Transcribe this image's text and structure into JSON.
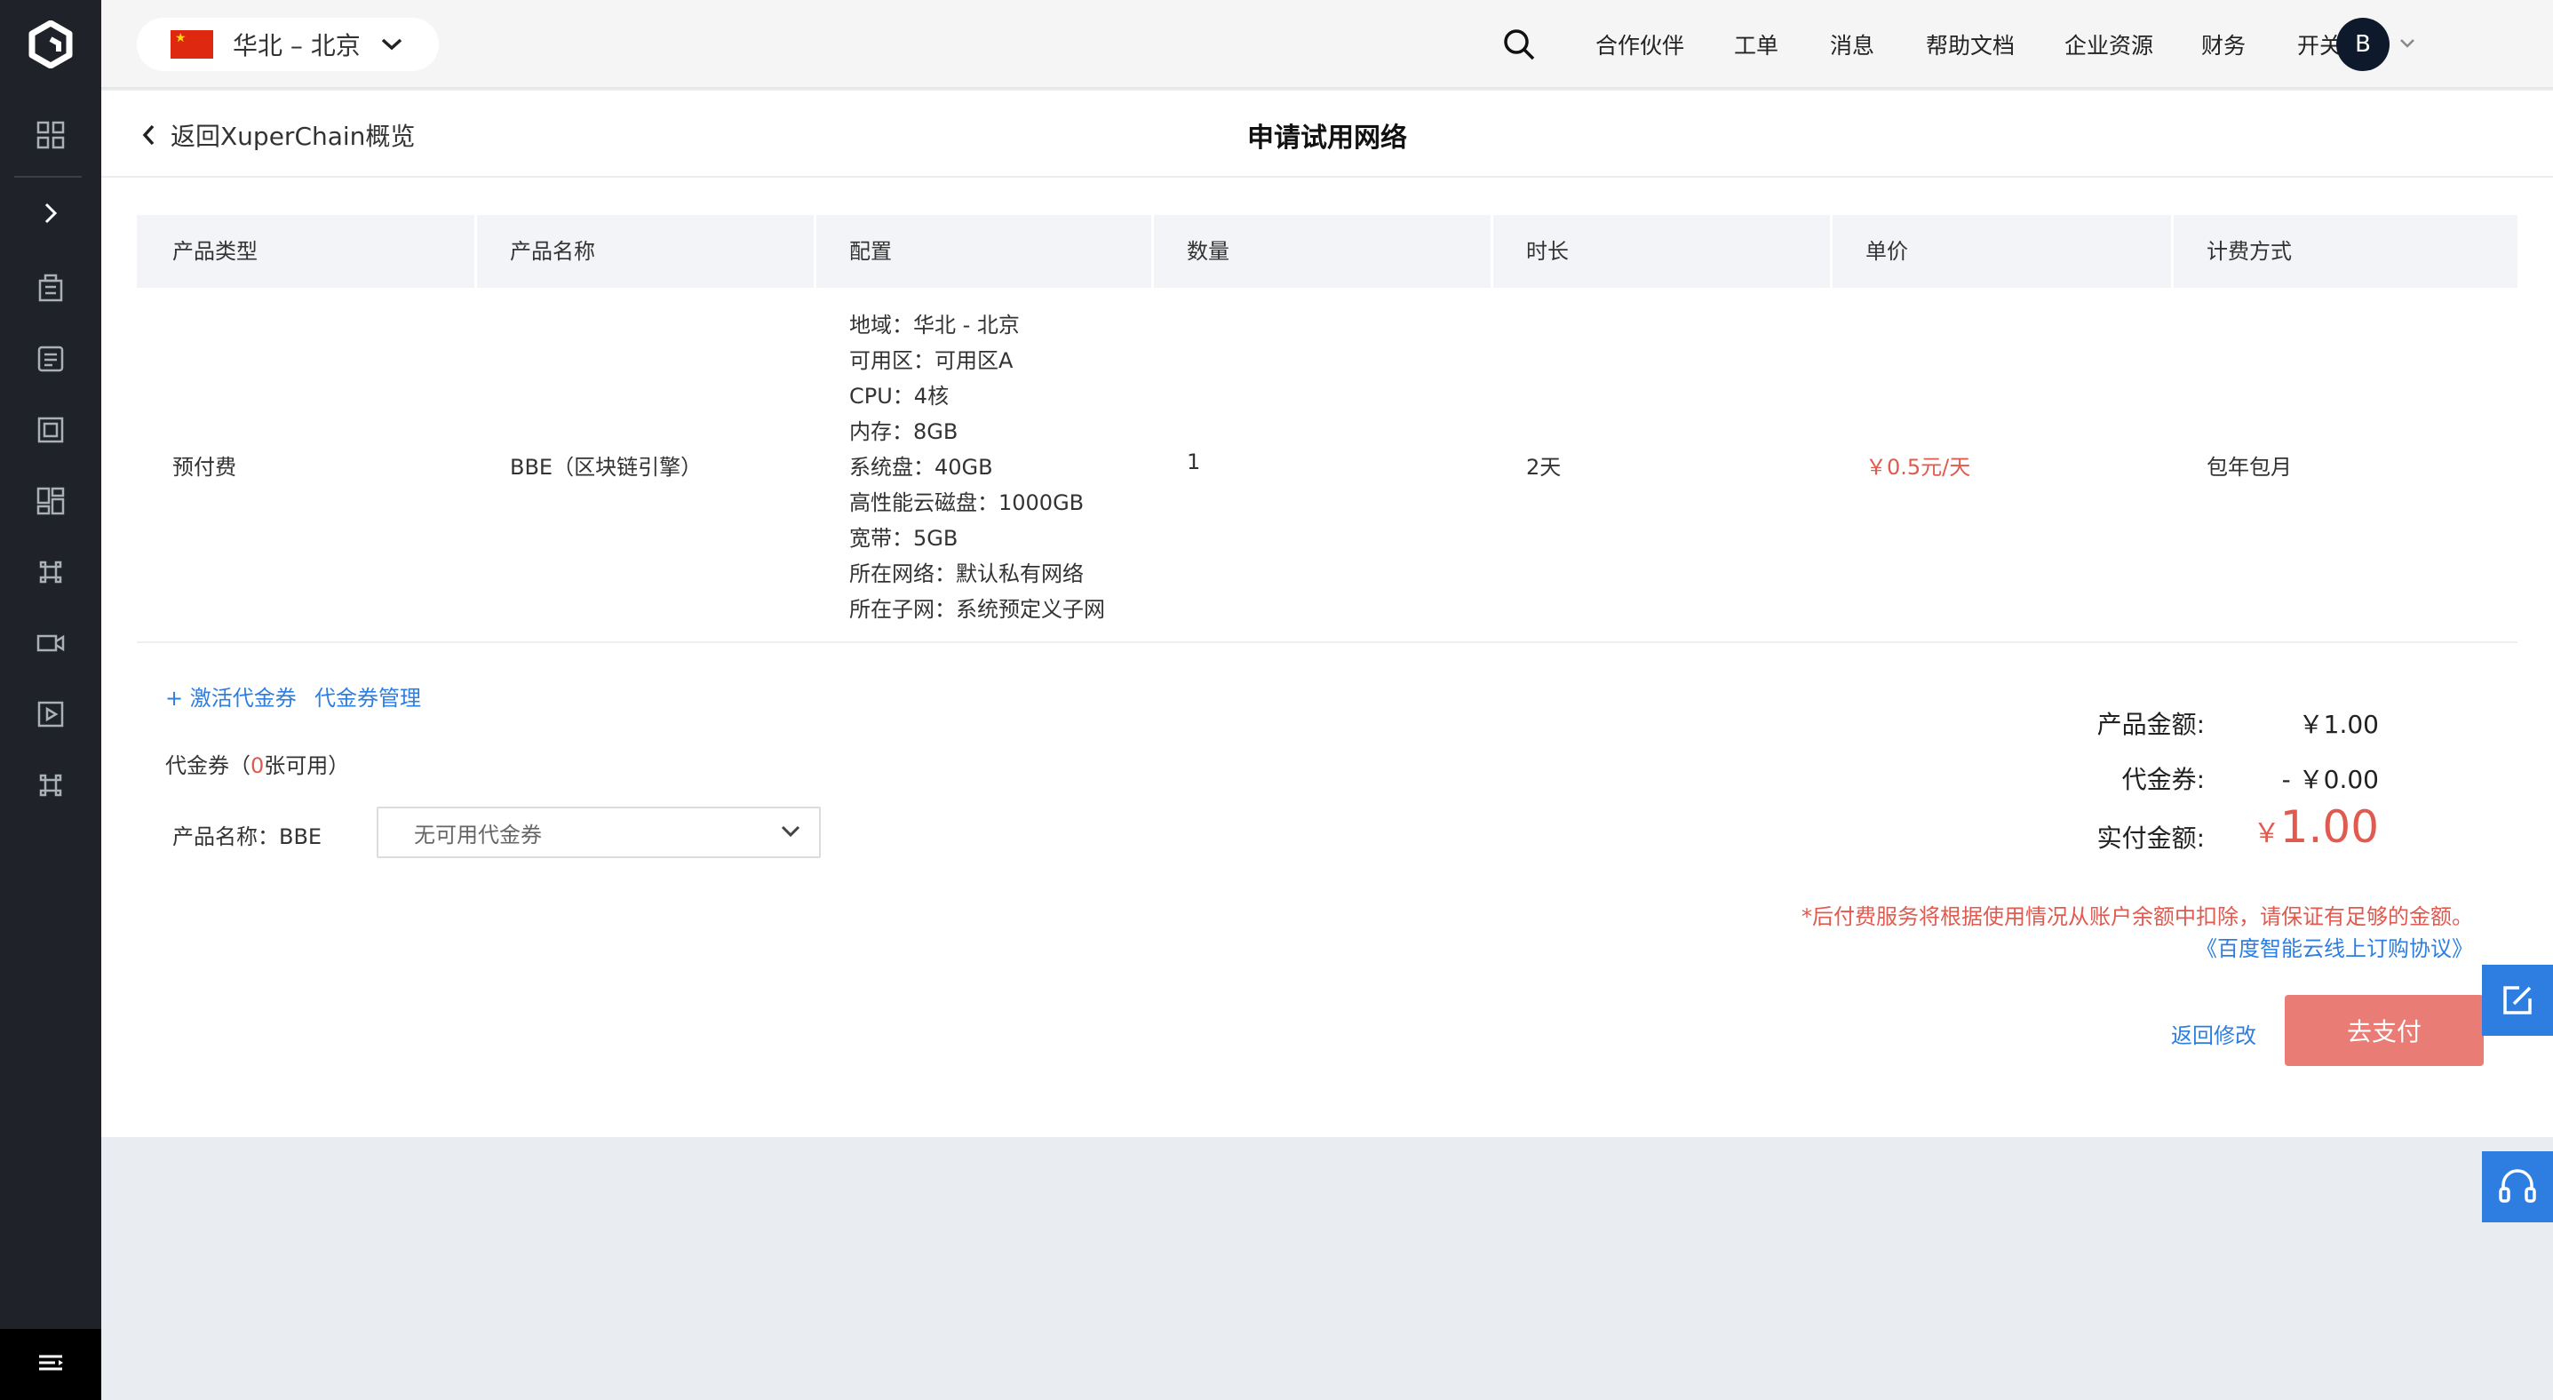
{
  "topbar": {
    "region": "华北 – 北京",
    "nav": [
      "合作伙伴",
      "工单",
      "消息",
      "帮助文档",
      "企业资源",
      "财务",
      "开关配置"
    ],
    "avatar": "B"
  },
  "subheader": {
    "back_label": "返回XuperChain概览",
    "title": "申请试用网络"
  },
  "table": {
    "headers": [
      "产品类型",
      "产品名称",
      "配置",
      "数量",
      "时长",
      "单价",
      "计费方式"
    ],
    "row": {
      "type": "预付费",
      "name": "BBE（区块链引擎）",
      "config": [
        "地域：华北 - 北京",
        "可用区：可用区A",
        "CPU：4核",
        "内存：8GB",
        "系统盘：40GB",
        "高性能云磁盘：1000GB",
        "宽带：5GB",
        "所在网络：默认私有网络",
        "所在子网：系统预定义子网"
      ],
      "quantity": "1",
      "duration": "2天",
      "unit_price": "￥0.5元/天",
      "billing": "包年包月"
    }
  },
  "voucher": {
    "activate_link": "+ 激活代金券",
    "manage_link": "代金券管理",
    "label_prefix": "代金券（",
    "available_count": "0",
    "label_suffix": "张可用）",
    "product_label": "产品名称：BBE",
    "select_value": "无可用代金券"
  },
  "summary": {
    "product_amount_label": "产品金额:",
    "product_amount": "￥1.00",
    "voucher_label": "代金券:",
    "voucher_amount": "- ￥0.00",
    "paid_label": "实付金额:",
    "paid_currency": "￥",
    "paid_amount": "1.00",
    "notice": "*后付费服务将根据使用情况从账户余额中扣除，请保证有足够的金额。",
    "agreement_link": "《百度智能云线上订购协议》",
    "modify_link": "返回修改",
    "pay_button": "去支付"
  },
  "colors": {
    "sidebar": "#1f2329",
    "accent": "#2d7ee0",
    "price_red": "#e05a4f",
    "pay_button": "#e97c74"
  },
  "icons": {
    "sidebar": [
      "grid-icon",
      "expand-icon",
      "building-icon",
      "list-icon",
      "frame-icon",
      "dashboard-icon",
      "command-icon",
      "video-icon",
      "play-icon",
      "command-icon",
      "menu-icon"
    ],
    "floating": [
      "edit-icon",
      "headset-icon"
    ]
  }
}
